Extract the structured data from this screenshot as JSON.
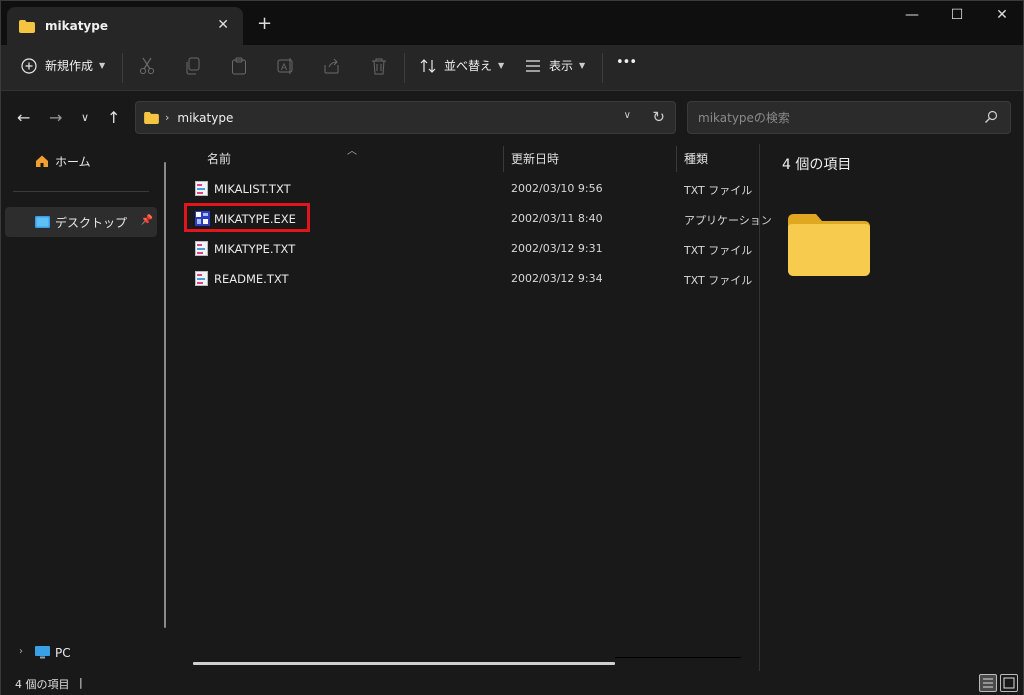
{
  "window": {
    "tab_title": "mikatype",
    "new_tab": "+",
    "minimize": "—",
    "maximize": "☐",
    "close": "✕"
  },
  "toolbar": {
    "new_label": "新規作成",
    "sort_label": "並べ替え",
    "view_label": "表示",
    "more": "•••"
  },
  "address": {
    "path": "mikatype",
    "search_placeholder": "mikatypeの検索"
  },
  "nav": {
    "home": "ホーム",
    "desktop": "デスクトップ",
    "pc": "PC"
  },
  "columns": {
    "name": "名前",
    "date": "更新日時",
    "type": "種類"
  },
  "files": [
    {
      "name": "MIKALIST.TXT",
      "date": "2002/03/10 9:56",
      "type": "TXT ファイル",
      "icon": "text-file-icon"
    },
    {
      "name": "MIKATYPE.EXE",
      "date": "2002/03/11 8:40",
      "type": "アプリケーション",
      "icon": "exe-file-icon"
    },
    {
      "name": "MIKATYPE.TXT",
      "date": "2002/03/12 9:31",
      "type": "TXT ファイル",
      "icon": "text-file-icon"
    },
    {
      "name": "README.TXT",
      "date": "2002/03/12 9:34",
      "type": "TXT ファイル",
      "icon": "text-file-icon"
    }
  ],
  "details": {
    "title": "4 個の項目"
  },
  "status": {
    "count": "4 個の項目",
    "cursor": "|"
  },
  "colors": {
    "highlight": "#e0161c",
    "folder": "#f5c542",
    "background": "#191919"
  }
}
